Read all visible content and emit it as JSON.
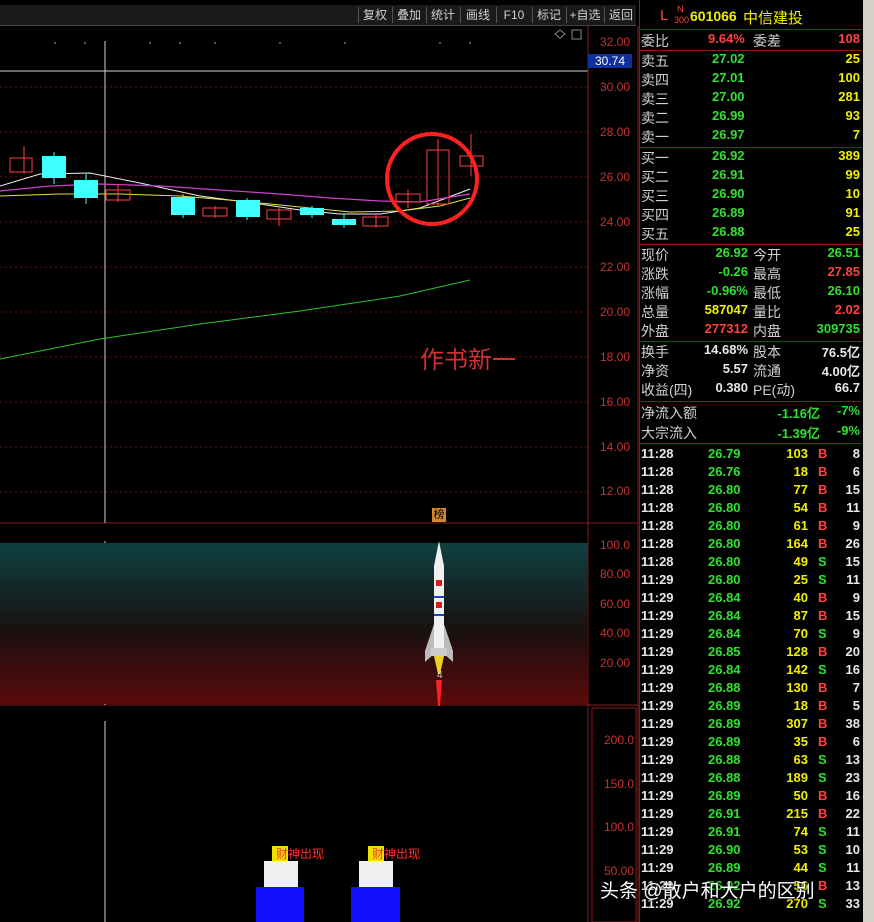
{
  "toolbar": {
    "buttons": [
      "复权",
      "叠加",
      "统计",
      "画线",
      "F10",
      "标记",
      "+自选",
      "返回"
    ]
  },
  "chart_top_marker": "30.74",
  "price_axis": [
    "32.00",
    "30.00",
    "28.00",
    "26.00",
    "24.00",
    "22.00",
    "20.00",
    "18.00",
    "16.00",
    "14.00",
    "12.00"
  ],
  "mid_axis": [
    "100.0",
    "80.00",
    "60.00",
    "40.00",
    "20.00"
  ],
  "bot_axis": [
    "200.0",
    "150.0",
    "100.0",
    "50.00"
  ],
  "overlay_text": "作书新一",
  "bang_label": "榜",
  "rocket_label": "4",
  "caishen_label": "财神出现",
  "watermark": "头条 @散户和大户的区别",
  "stock": {
    "market_letter": "L",
    "badge_top": "N",
    "badge_bottom": "300",
    "code": "601066",
    "name": "中信建投"
  },
  "order_summary": {
    "ratio_label": "委比",
    "ratio": "9.64%",
    "diff_label": "委差",
    "diff": "108"
  },
  "asks": [
    {
      "label": "卖五",
      "price": "27.02",
      "vol": "25"
    },
    {
      "label": "卖四",
      "price": "27.01",
      "vol": "100"
    },
    {
      "label": "卖三",
      "price": "27.00",
      "vol": "281"
    },
    {
      "label": "卖二",
      "price": "26.99",
      "vol": "93"
    },
    {
      "label": "卖一",
      "price": "26.97",
      "vol": "7"
    }
  ],
  "bids": [
    {
      "label": "买一",
      "price": "26.92",
      "vol": "389"
    },
    {
      "label": "买二",
      "price": "26.91",
      "vol": "99"
    },
    {
      "label": "买三",
      "price": "26.90",
      "vol": "10"
    },
    {
      "label": "买四",
      "price": "26.89",
      "vol": "91"
    },
    {
      "label": "买五",
      "price": "26.88",
      "vol": "25"
    }
  ],
  "quote": [
    {
      "l1": "现价",
      "v1": "26.92",
      "c1": "green",
      "l2": "今开",
      "v2": "26.51",
      "c2": "green"
    },
    {
      "l1": "涨跌",
      "v1": "-0.26",
      "c1": "green",
      "l2": "最高",
      "v2": "27.85",
      "c2": "red"
    },
    {
      "l1": "涨幅",
      "v1": "-0.96%",
      "c1": "green",
      "l2": "最低",
      "v2": "26.10",
      "c2": "green"
    },
    {
      "l1": "总量",
      "v1": "587047",
      "c1": "yellow",
      "l2": "量比",
      "v2": "2.02",
      "c2": "red"
    },
    {
      "l1": "外盘",
      "v1": "277312",
      "c1": "red",
      "l2": "内盘",
      "v2": "309735",
      "c2": "green"
    }
  ],
  "fundamentals": [
    {
      "l1": "换手",
      "v1": "14.68%",
      "l2": "股本",
      "v2": "76.5亿"
    },
    {
      "l1": "净资",
      "v1": "5.57",
      "l2": "流通",
      "v2": "4.00亿"
    },
    {
      "l1": "收益(四)",
      "v1": "0.380",
      "l2": "PE(动)",
      "v2": "66.7"
    }
  ],
  "flows": [
    {
      "label": "净流入额",
      "value": "-1.16亿",
      "pct": "-7%"
    },
    {
      "label": "大宗流入",
      "value": "-1.39亿",
      "pct": "-9%"
    }
  ],
  "ticks": [
    {
      "t": "11:28",
      "p": "26.79",
      "v": "103",
      "s": "B",
      "n": "8"
    },
    {
      "t": "11:28",
      "p": "26.76",
      "v": "18",
      "s": "B",
      "n": "6"
    },
    {
      "t": "11:28",
      "p": "26.80",
      "v": "77",
      "s": "B",
      "n": "15"
    },
    {
      "t": "11:28",
      "p": "26.80",
      "v": "54",
      "s": "B",
      "n": "11"
    },
    {
      "t": "11:28",
      "p": "26.80",
      "v": "61",
      "s": "B",
      "n": "9"
    },
    {
      "t": "11:28",
      "p": "26.80",
      "v": "164",
      "s": "B",
      "n": "26"
    },
    {
      "t": "11:28",
      "p": "26.80",
      "v": "49",
      "s": "S",
      "n": "15"
    },
    {
      "t": "11:29",
      "p": "26.80",
      "v": "25",
      "s": "S",
      "n": "11"
    },
    {
      "t": "11:29",
      "p": "26.84",
      "v": "40",
      "s": "B",
      "n": "9"
    },
    {
      "t": "11:29",
      "p": "26.84",
      "v": "87",
      "s": "B",
      "n": "15"
    },
    {
      "t": "11:29",
      "p": "26.84",
      "v": "70",
      "s": "S",
      "n": "9"
    },
    {
      "t": "11:29",
      "p": "26.85",
      "v": "128",
      "s": "B",
      "n": "20"
    },
    {
      "t": "11:29",
      "p": "26.84",
      "v": "142",
      "s": "S",
      "n": "16"
    },
    {
      "t": "11:29",
      "p": "26.88",
      "v": "130",
      "s": "B",
      "n": "7"
    },
    {
      "t": "11:29",
      "p": "26.89",
      "v": "18",
      "s": "B",
      "n": "5"
    },
    {
      "t": "11:29",
      "p": "26.89",
      "v": "307",
      "s": "B",
      "n": "38"
    },
    {
      "t": "11:29",
      "p": "26.89",
      "v": "35",
      "s": "B",
      "n": "6"
    },
    {
      "t": "11:29",
      "p": "26.88",
      "v": "63",
      "s": "S",
      "n": "13"
    },
    {
      "t": "11:29",
      "p": "26.88",
      "v": "189",
      "s": "S",
      "n": "23"
    },
    {
      "t": "11:29",
      "p": "26.89",
      "v": "50",
      "s": "B",
      "n": "16"
    },
    {
      "t": "11:29",
      "p": "26.91",
      "v": "215",
      "s": "B",
      "n": "22"
    },
    {
      "t": "11:29",
      "p": "26.91",
      "v": "74",
      "s": "S",
      "n": "11"
    },
    {
      "t": "11:29",
      "p": "26.90",
      "v": "53",
      "s": "S",
      "n": "10"
    },
    {
      "t": "11:29",
      "p": "26.89",
      "v": "44",
      "s": "S",
      "n": "11"
    },
    {
      "t": "11:29",
      "p": "26.92",
      "v": "56",
      "s": "B",
      "n": "13"
    },
    {
      "t": "11:29",
      "p": "26.92",
      "v": "270",
      "s": "S",
      "n": "33"
    }
  ]
}
